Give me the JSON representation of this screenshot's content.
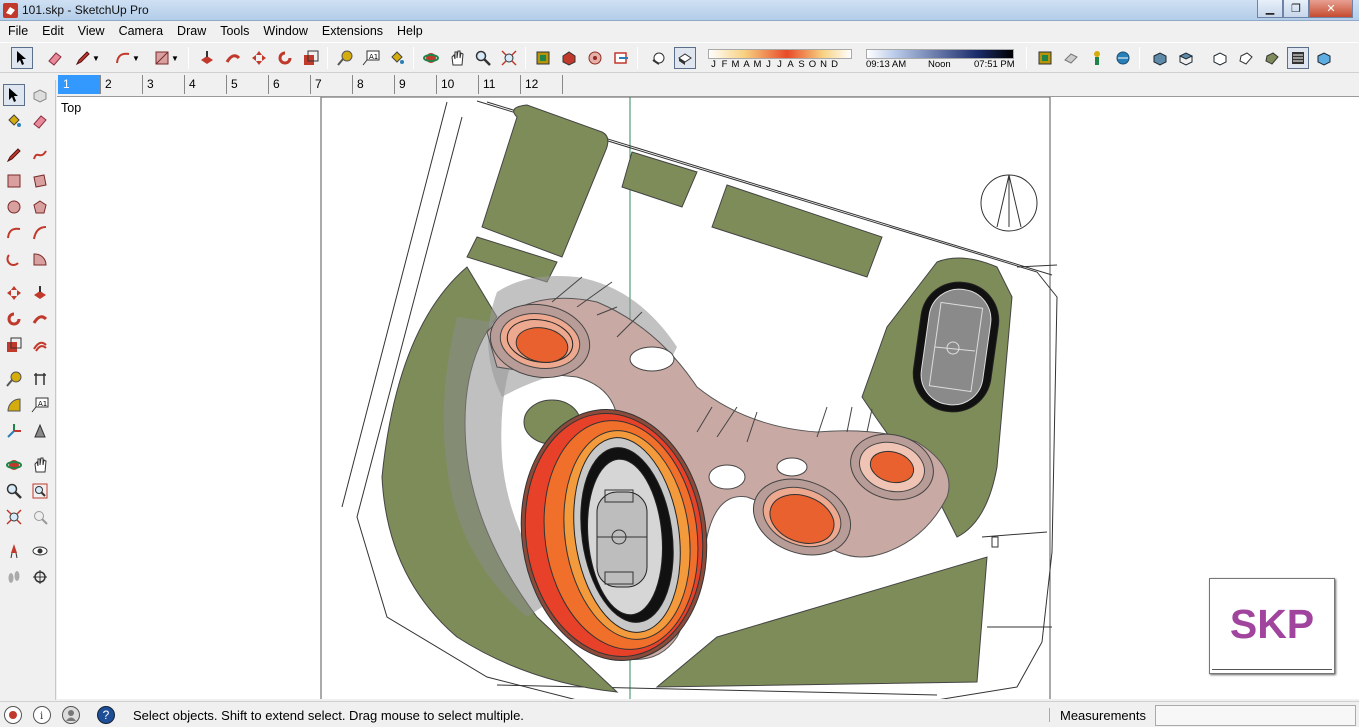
{
  "window": {
    "title": "101.skp - SketchUp Pro",
    "app_icon": "sketchup-logo-icon"
  },
  "menubar": [
    "File",
    "Edit",
    "View",
    "Camera",
    "Draw",
    "Tools",
    "Window",
    "Extensions",
    "Help"
  ],
  "toolbar": {
    "tools": [
      "select-icon",
      "eraser-icon",
      "pencil-icon",
      "arc-icon",
      "rectangle-icon",
      "push-pull-icon",
      "follow-me-icon",
      "move-icon",
      "rotate-icon",
      "scale-icon",
      "tape-measure-icon",
      "text-icon",
      "paint-bucket-icon",
      "orbit-icon",
      "pan-icon",
      "zoom-icon",
      "zoom-extents-icon",
      "warehouse-icon",
      "extension-warehouse-icon",
      "share-model-icon",
      "send-to-layout-icon",
      "display-shadows-icon",
      "toggle-shadows-icon",
      "iso-view-icon",
      "top-view-icon",
      "front-view-icon",
      "right-view-icon",
      "back-view-icon",
      "left-view-icon",
      "xray-icon",
      "back-edges-icon",
      "wireframe-icon",
      "hidden-line-icon",
      "shaded-icon",
      "shaded-textures-icon",
      "monochrome-icon"
    ],
    "shadow_months": [
      "J",
      "F",
      "M",
      "A",
      "M",
      "J",
      "J",
      "A",
      "S",
      "O",
      "N",
      "D"
    ],
    "shadow_time": {
      "start": "09:13 AM",
      "mid": "Noon",
      "end": "07:51 PM"
    }
  },
  "scenes": {
    "tabs": [
      "1",
      "2",
      "3",
      "4",
      "5",
      "6",
      "7",
      "8",
      "9",
      "10",
      "11",
      "12"
    ],
    "active": "1"
  },
  "left_tools": [
    "select-icon",
    "make-component-icon",
    "paint-bucket-icon",
    "eraser-icon",
    "line-icon",
    "freehand-icon",
    "rectangle-icon",
    "rotated-rectangle-icon",
    "circle-icon",
    "polygon-icon",
    "arc-icon",
    "two-point-arc-icon",
    "three-point-arc-icon",
    "pie-icon",
    "move-icon",
    "push-pull-icon",
    "rotate-icon",
    "follow-me-icon",
    "scale-icon",
    "offset-icon",
    "tape-measure-icon",
    "dimension-icon",
    "protractor-icon",
    "text-icon",
    "axes-icon",
    "3d-text-icon",
    "orbit-icon",
    "pan-icon",
    "zoom-icon",
    "zoom-window-icon",
    "zoom-extents-icon",
    "previous-view-icon",
    "position-camera-icon",
    "look-around-icon",
    "walk-icon",
    "section-plane-icon"
  ],
  "viewport": {
    "view_name": "Top",
    "watermark": "SKP"
  },
  "statusbar": {
    "icons": [
      "geo-location-icon",
      "credits-icon",
      "user-account-icon",
      "instructor-help-icon"
    ],
    "message": "Select objects. Shift to extend select. Drag mouse to select multiple.",
    "measurements_label": "Measurements",
    "measurements_value": ""
  },
  "colors": {
    "accent": "#3399ff",
    "grass": "#7d8c58",
    "stadium_orange": "#e84a25",
    "plaza_pink": "#c9a9a3",
    "watermark": "#a1449e"
  }
}
